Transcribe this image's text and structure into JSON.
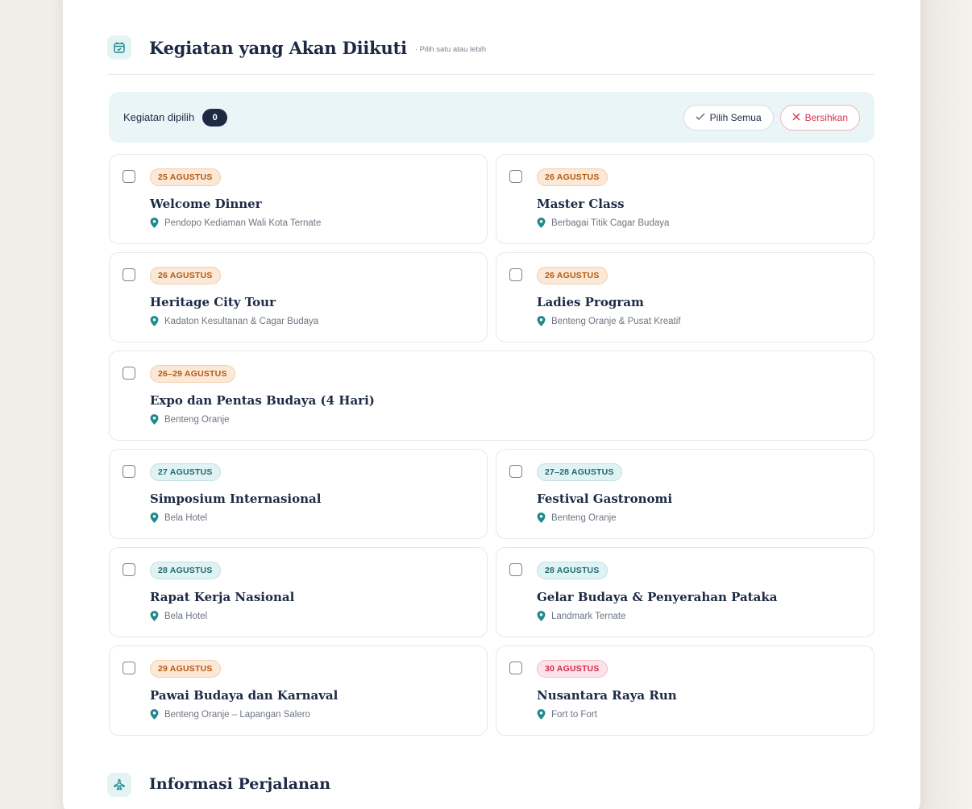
{
  "section": {
    "icon": "calendar-check-icon",
    "title": "Kegiatan yang Akan Diikuti",
    "hint": "· Pilih satu atau lebih"
  },
  "selection": {
    "label": "Kegiatan dipilih",
    "count": "0",
    "select_all_label": "Pilih Semua",
    "clear_label": "Bersihkan"
  },
  "events": [
    {
      "date": "25 AGUSTUS",
      "date_color": "orange",
      "title": "Welcome Dinner",
      "location": "Pendopo Kediaman Wali Kota Ternate",
      "checked": false
    },
    {
      "date": "26 AGUSTUS",
      "date_color": "orange",
      "title": "Master Class",
      "location": "Berbagai Titik Cagar Budaya",
      "checked": false
    },
    {
      "date": "26 AGUSTUS",
      "date_color": "orange",
      "title": "Heritage City Tour",
      "location": "Kadaton Kesultanan & Cagar Budaya",
      "checked": false
    },
    {
      "date": "26 AGUSTUS",
      "date_color": "orange",
      "title": "Ladies Program",
      "location": "Benteng Oranje & Pusat Kreatif",
      "checked": false
    },
    {
      "date": "26–29 AGUSTUS",
      "date_color": "orange",
      "title": "Expo dan Pentas Budaya (4 Hari)",
      "location": "Benteng Oranje",
      "checked": false
    },
    {
      "date": "27 AGUSTUS",
      "date_color": "teal",
      "title": "Simposium Internasional",
      "location": "Bela Hotel",
      "checked": false
    },
    {
      "date": "27–28 AGUSTUS",
      "date_color": "teal",
      "title": "Festival Gastronomi",
      "location": "Benteng Oranje",
      "checked": false
    },
    {
      "date": "28 AGUSTUS",
      "date_color": "teal",
      "title": "Rapat Kerja Nasional",
      "location": "Bela Hotel",
      "checked": false
    },
    {
      "date": "28 AGUSTUS",
      "date_color": "teal",
      "title": "Gelar Budaya & Penyerahan Pataka",
      "location": "Landmark Ternate",
      "checked": false
    },
    {
      "date": "29 AGUSTUS",
      "date_color": "orange",
      "title": "Pawai Budaya dan Karnaval",
      "location": "Benteng Oranje – Lapangan Salero",
      "checked": false
    },
    {
      "date": "30 AGUSTUS",
      "date_color": "pink",
      "title": "Nusantara Raya Run",
      "location": "Fort to Fort",
      "checked": false
    }
  ],
  "travel_section": {
    "icon": "airplane-icon",
    "title": "Informasi Perjalanan"
  },
  "colors": {
    "accent_teal": "#1e8a8e",
    "navy": "#1c2a44",
    "clear_red": "#d8344b",
    "date_orange": "#b45a12",
    "date_teal": "#1d6b70",
    "date_pink": "#d12a4b"
  }
}
